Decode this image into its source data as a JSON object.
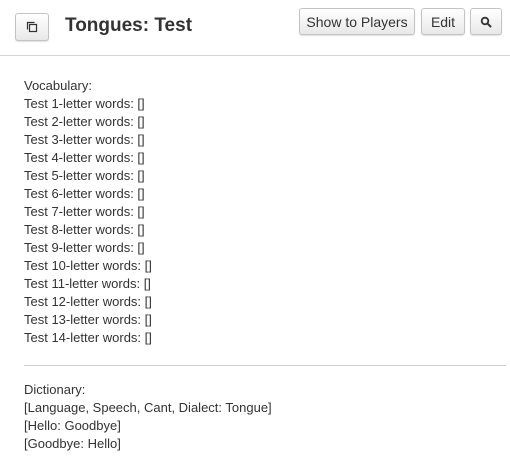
{
  "header": {
    "title": "Tongues: Test",
    "show_to_players_label": "Show to Players",
    "edit_label": "Edit",
    "popout_icon": "popout-icon",
    "search_icon": "search-icon"
  },
  "vocabulary": {
    "heading": "Vocabulary:",
    "lines": [
      "Test 1-letter words: []",
      "Test 2-letter words: []",
      "Test 3-letter words: []",
      "Test 4-letter words: []",
      "Test 5-letter words: []",
      "Test 6-letter words: []",
      "Test 7-letter words: []",
      "Test 8-letter words: []",
      "Test 9-letter words: []",
      "Test 10-letter words: []",
      "Test 11-letter words: []",
      "Test 12-letter words: []",
      "Test 13-letter words: []",
      "Test 14-letter words: []"
    ]
  },
  "dictionary": {
    "heading": "Dictionary:",
    "lines": [
      "[Language, Speech, Cant, Dialect: Tongue]",
      "[Hello: Goodbye]",
      "[Goodbye: Hello]"
    ]
  }
}
